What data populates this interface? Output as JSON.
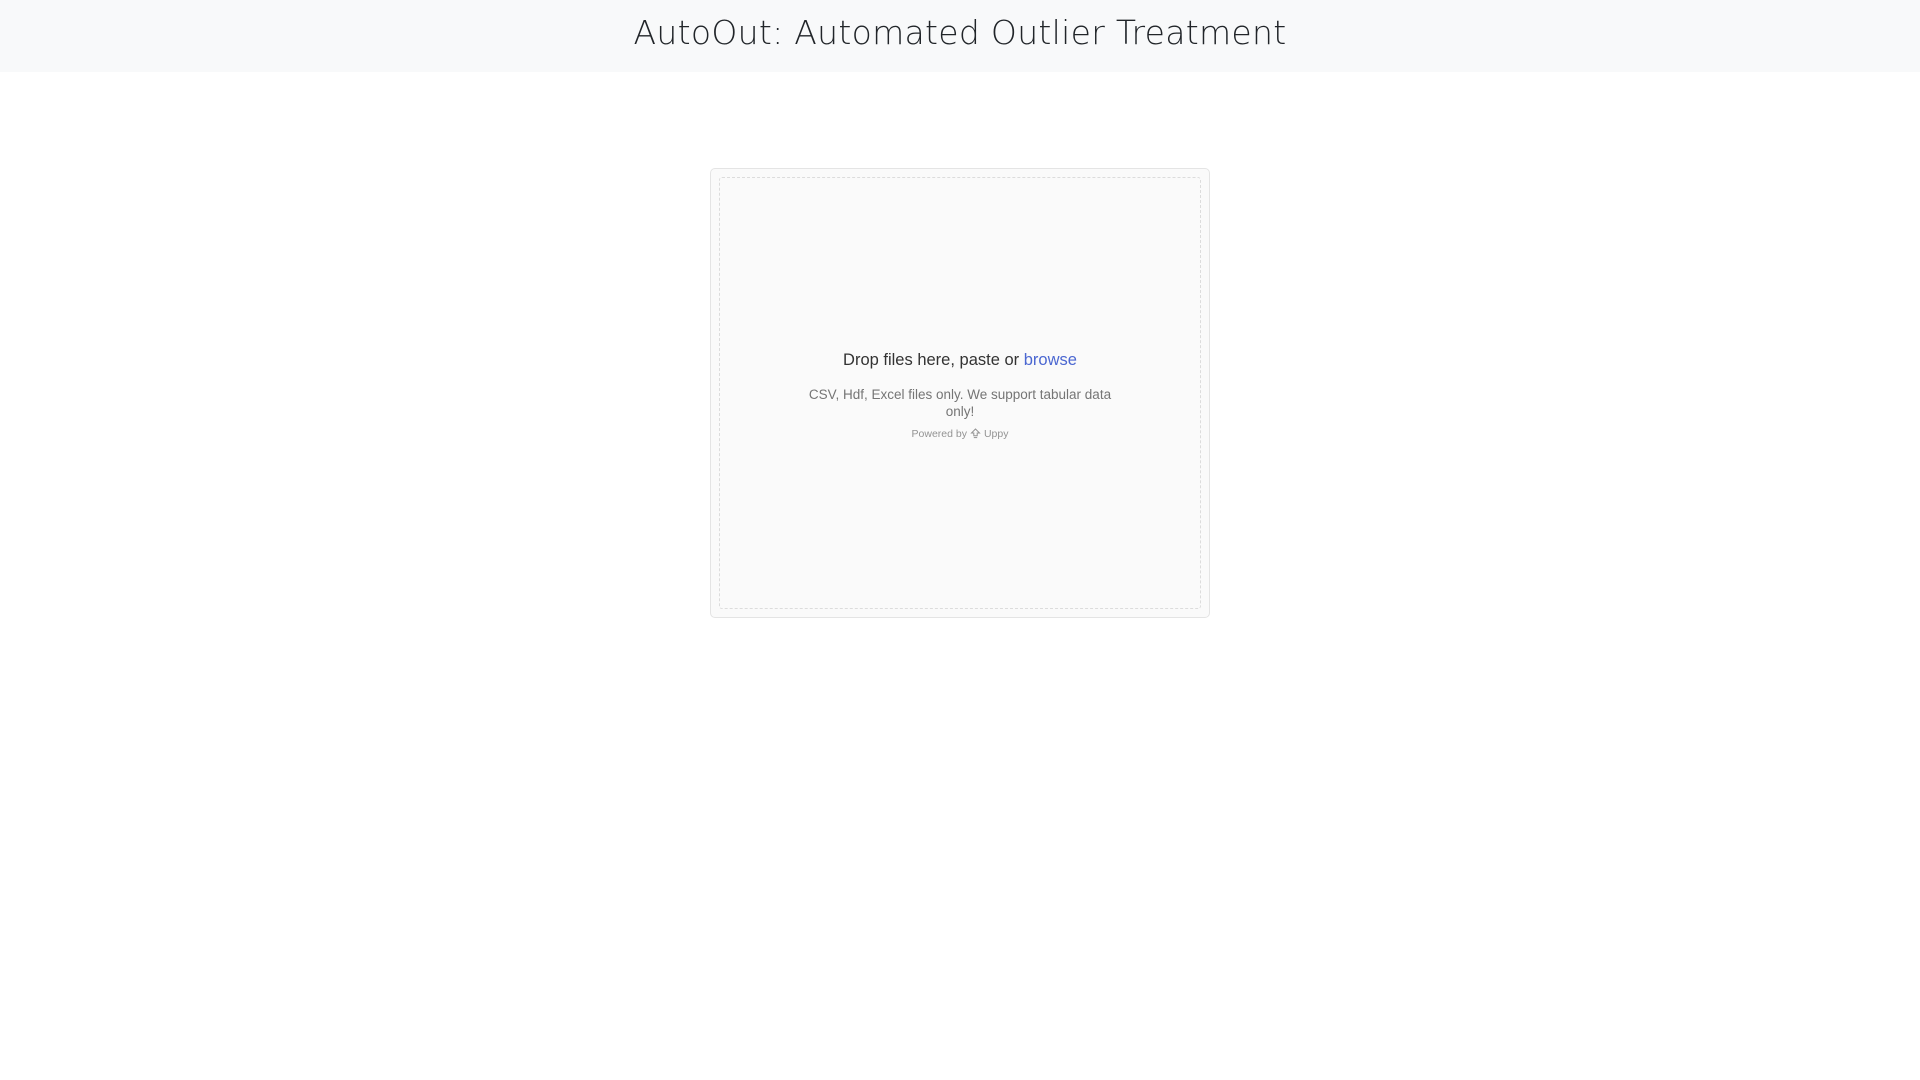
{
  "header": {
    "title": "AutoOut: Automated Outlier Treatment"
  },
  "uploader": {
    "drop_prefix": "Drop files here, paste or",
    "browse_label": "browse",
    "note": "CSV, Hdf, Excel files only. We support tabular data only!",
    "powered_by_label": "Powered by",
    "brand_name": "Uppy",
    "brand_icon": "uppy-logo-icon"
  },
  "colors": {
    "header_background": "#f8f9fa",
    "browse_link": "#4b67d1",
    "dropzone_background": "#fafafa"
  }
}
